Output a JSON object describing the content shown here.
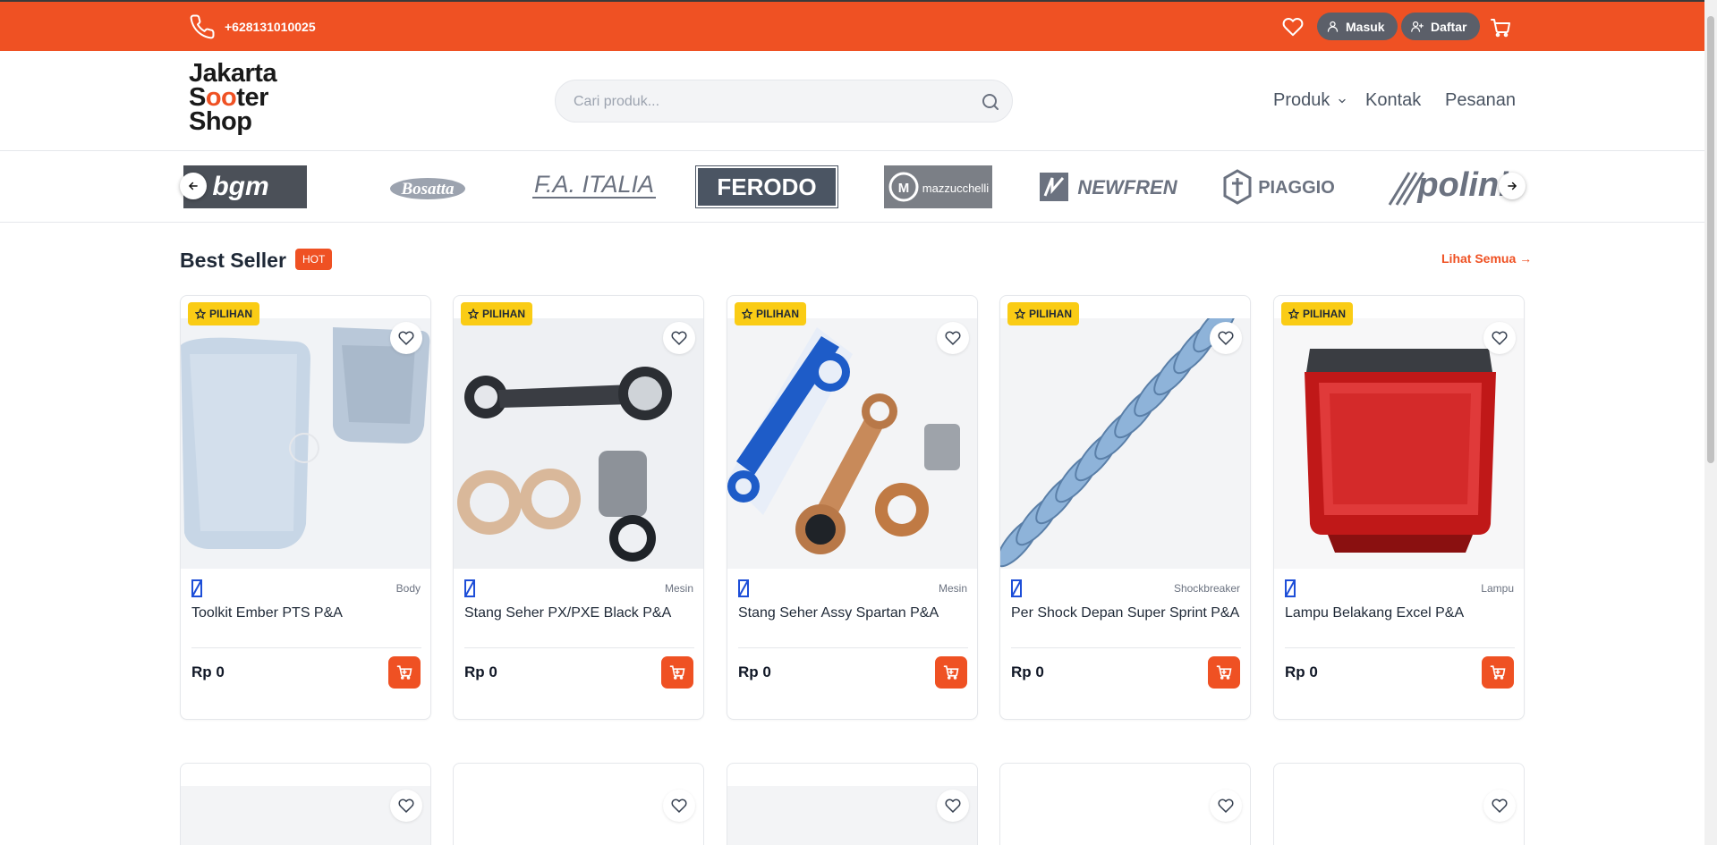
{
  "topbar": {
    "phone": "+628131010025",
    "login_label": "Masuk",
    "register_label": "Daftar"
  },
  "header": {
    "logo": {
      "line1": "Jakarta",
      "line2a": "S",
      "line2b": "oo",
      "line2c": "ter",
      "line3": "Shop"
    },
    "search_placeholder": "Cari produk...",
    "nav": {
      "produk": "Produk",
      "kontak": "Kontak",
      "pesanan": "Pesanan"
    }
  },
  "brands": [
    "bgm",
    "Bosatta",
    "F.A. ITALIA",
    "FERODO",
    "mazzucchelli",
    "NEWFREN",
    "PIAGGIO",
    "polini"
  ],
  "section": {
    "title": "Best Seller",
    "badge": "HOT",
    "see_all": "Lihat Semua →"
  },
  "products": [
    {
      "badge": "PILIHAN",
      "category": "Body",
      "name": "Toolkit Ember PTS P&A",
      "price": "Rp 0"
    },
    {
      "badge": "PILIHAN",
      "category": "Mesin",
      "name": "Stang Seher PX/PXE Black P&A",
      "price": "Rp 0"
    },
    {
      "badge": "PILIHAN",
      "category": "Mesin",
      "name": "Stang Seher Assy Spartan P&A",
      "price": "Rp 0"
    },
    {
      "badge": "PILIHAN",
      "category": "Shockbreaker",
      "name": "Per Shock Depan Super Sprint P&A",
      "price": "Rp 0"
    },
    {
      "badge": "PILIHAN",
      "category": "Lampu",
      "name": "Lampu Belakang Excel P&A",
      "price": "Rp 0"
    }
  ],
  "colors": {
    "accent": "#ef5123",
    "badge": "#facc15",
    "pill": "#5b5f69"
  }
}
